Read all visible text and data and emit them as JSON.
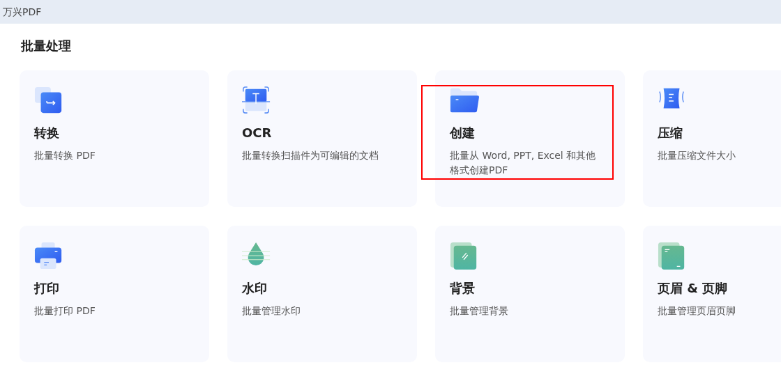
{
  "window": {
    "title": "万兴PDF"
  },
  "section": {
    "heading": "批量处理"
  },
  "tools": [
    {
      "kind": "convert",
      "title": "转换",
      "description": "批量转换 PDF",
      "highlighted": false
    },
    {
      "kind": "ocr",
      "title": "OCR",
      "description": "批量转换扫描件为可编辑的文档",
      "highlighted": false
    },
    {
      "kind": "folder",
      "title": "创建",
      "description": "批量从 Word, PPT, Excel 和其他格式创建PDF",
      "highlighted": true
    },
    {
      "kind": "compress",
      "title": "压缩",
      "description": "批量压缩文件大小",
      "highlighted": false
    },
    {
      "kind": "printer",
      "title": "打印",
      "description": "批量打印 PDF",
      "highlighted": false
    },
    {
      "kind": "watermark",
      "title": "水印",
      "description": "批量管理水印",
      "highlighted": false
    },
    {
      "kind": "background",
      "title": "背景",
      "description": "批量管理背景",
      "highlighted": false
    },
    {
      "kind": "header-footer",
      "title": "页眉 & 页脚",
      "description": "批量管理页眉页脚",
      "highlighted": false
    }
  ]
}
